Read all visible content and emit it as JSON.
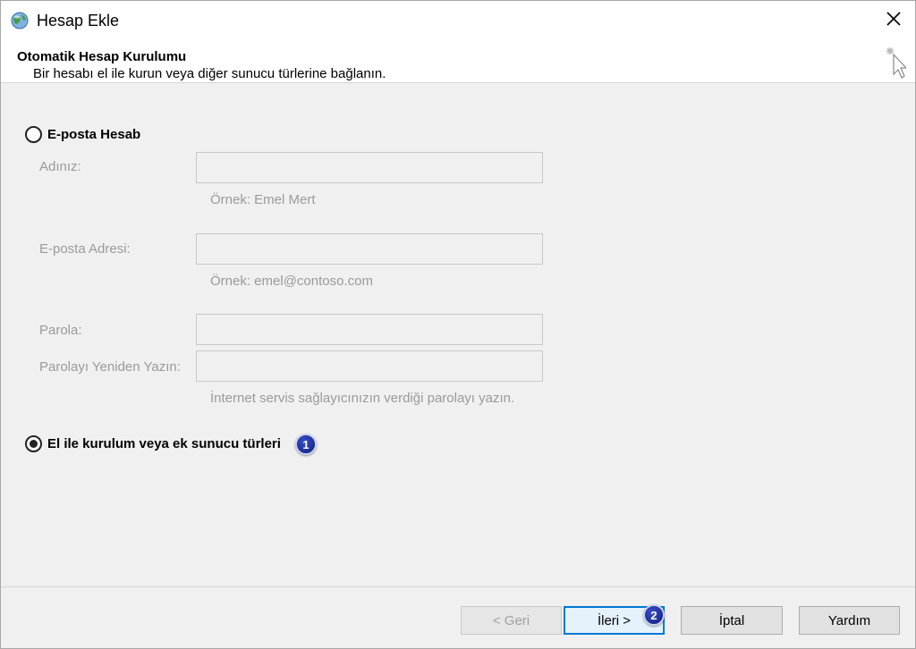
{
  "window": {
    "title": "Hesap Ekle",
    "close_symbol": "✕"
  },
  "header": {
    "title": "Otomatik Hesap Kurulumu",
    "subtitle": "Bir hesabı el ile kurun veya diğer sunucu türlerine bağlanın."
  },
  "email_account": {
    "label": "E-posta Hesabı",
    "selected": false,
    "name": {
      "label": "Adınız:",
      "value": "",
      "hint": "Örnek: Emel Mert"
    },
    "email": {
      "label": "E-posta Adresi:",
      "value": "",
      "hint": "Örnek: emel@contoso.com"
    },
    "password": {
      "label": "Parola:",
      "value": ""
    },
    "password_confirm": {
      "label": "Parolayı Yeniden Yazın:",
      "value": ""
    },
    "password_hint": "İnternet servis sağlayıcınızın verdiği parolayı yazın."
  },
  "manual_setup": {
    "label": "El ile kurulum veya ek sunucu türleri",
    "selected": true
  },
  "callouts": {
    "one": "1",
    "two": "2"
  },
  "buttons": {
    "back": "< Geri",
    "next": "İleri >",
    "cancel": "İptal",
    "help": "Yardım"
  },
  "colors": {
    "callout": "#1a2a9c",
    "default_button_border": "#0078d7",
    "disabled_text": "#9a9a9a"
  }
}
